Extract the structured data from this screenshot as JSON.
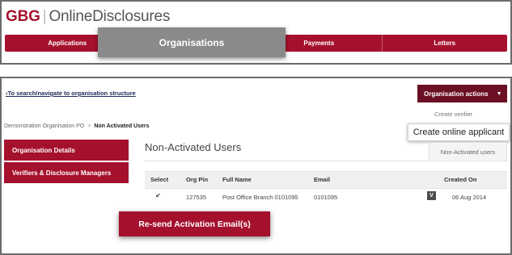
{
  "header": {
    "brand_gbg": "GBG",
    "brand_separator": "|",
    "brand_name": "OnlineDisclosures"
  },
  "nav": {
    "applications": "Applications",
    "organisations": "Organisations",
    "payments": "Payments",
    "letters": "Letters"
  },
  "toolbar": {
    "back_link": "To search/navigate to organisation structure",
    "back_icon": "‹",
    "org_actions": "Organisation actions",
    "org_actions_icon": "▼"
  },
  "org_menu": {
    "create_verifier": "Create verifier",
    "create_online_applicant": "Create online applicant",
    "non_activated_users": "Non-Activated users"
  },
  "breadcrumb": {
    "parent": "Demonstration Organisation PO",
    "separator": ">",
    "current": "Non Activated Users"
  },
  "sidebar": {
    "items": [
      {
        "label": "Organisation Details"
      },
      {
        "label": "Verifiers & Disclosure Managers"
      }
    ]
  },
  "main": {
    "title": "Non-Activated Users",
    "table": {
      "columns": [
        "Select",
        "Org Pin",
        "Full Name",
        "Email",
        "Created On"
      ],
      "rows": [
        {
          "selected": "✔",
          "org_pin": "127535",
          "full_name": "Post Office Branch 0101095",
          "email": "0101095",
          "verify_label": "V",
          "created_on": "06 Aug 2014"
        }
      ]
    },
    "resend_button": "Re-send Activation Email(s)"
  },
  "colors": {
    "brand_red": "#a5112d",
    "dark_red": "#6b0f25",
    "active_nav_gray": "#8a8a8a"
  }
}
